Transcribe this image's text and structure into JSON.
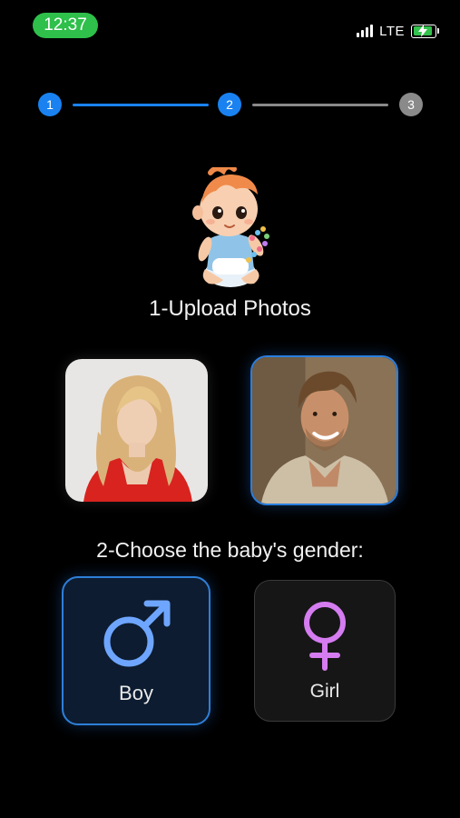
{
  "status_bar": {
    "time": "12:37",
    "network": "LTE",
    "time_pill_color": "#2ec04a",
    "battery_color": "#33c24d"
  },
  "stepper": {
    "steps": [
      "1",
      "2",
      "3"
    ],
    "current_step": 2,
    "active_color": "#1a82f0",
    "inactive_color": "#8a8a8a"
  },
  "upload": {
    "title": "1-Upload Photos",
    "photos": [
      {
        "name": "parent-photo-woman",
        "selected": false
      },
      {
        "name": "parent-photo-man",
        "selected": true
      }
    ]
  },
  "gender": {
    "title": "2-Choose the baby's gender:",
    "options": [
      {
        "label": "Boy",
        "icon": "male-symbol-icon",
        "color": "#6ea6ff",
        "selected": true
      },
      {
        "label": "Girl",
        "icon": "female-symbol-icon",
        "color": "#d57cf0",
        "selected": false
      }
    ]
  }
}
